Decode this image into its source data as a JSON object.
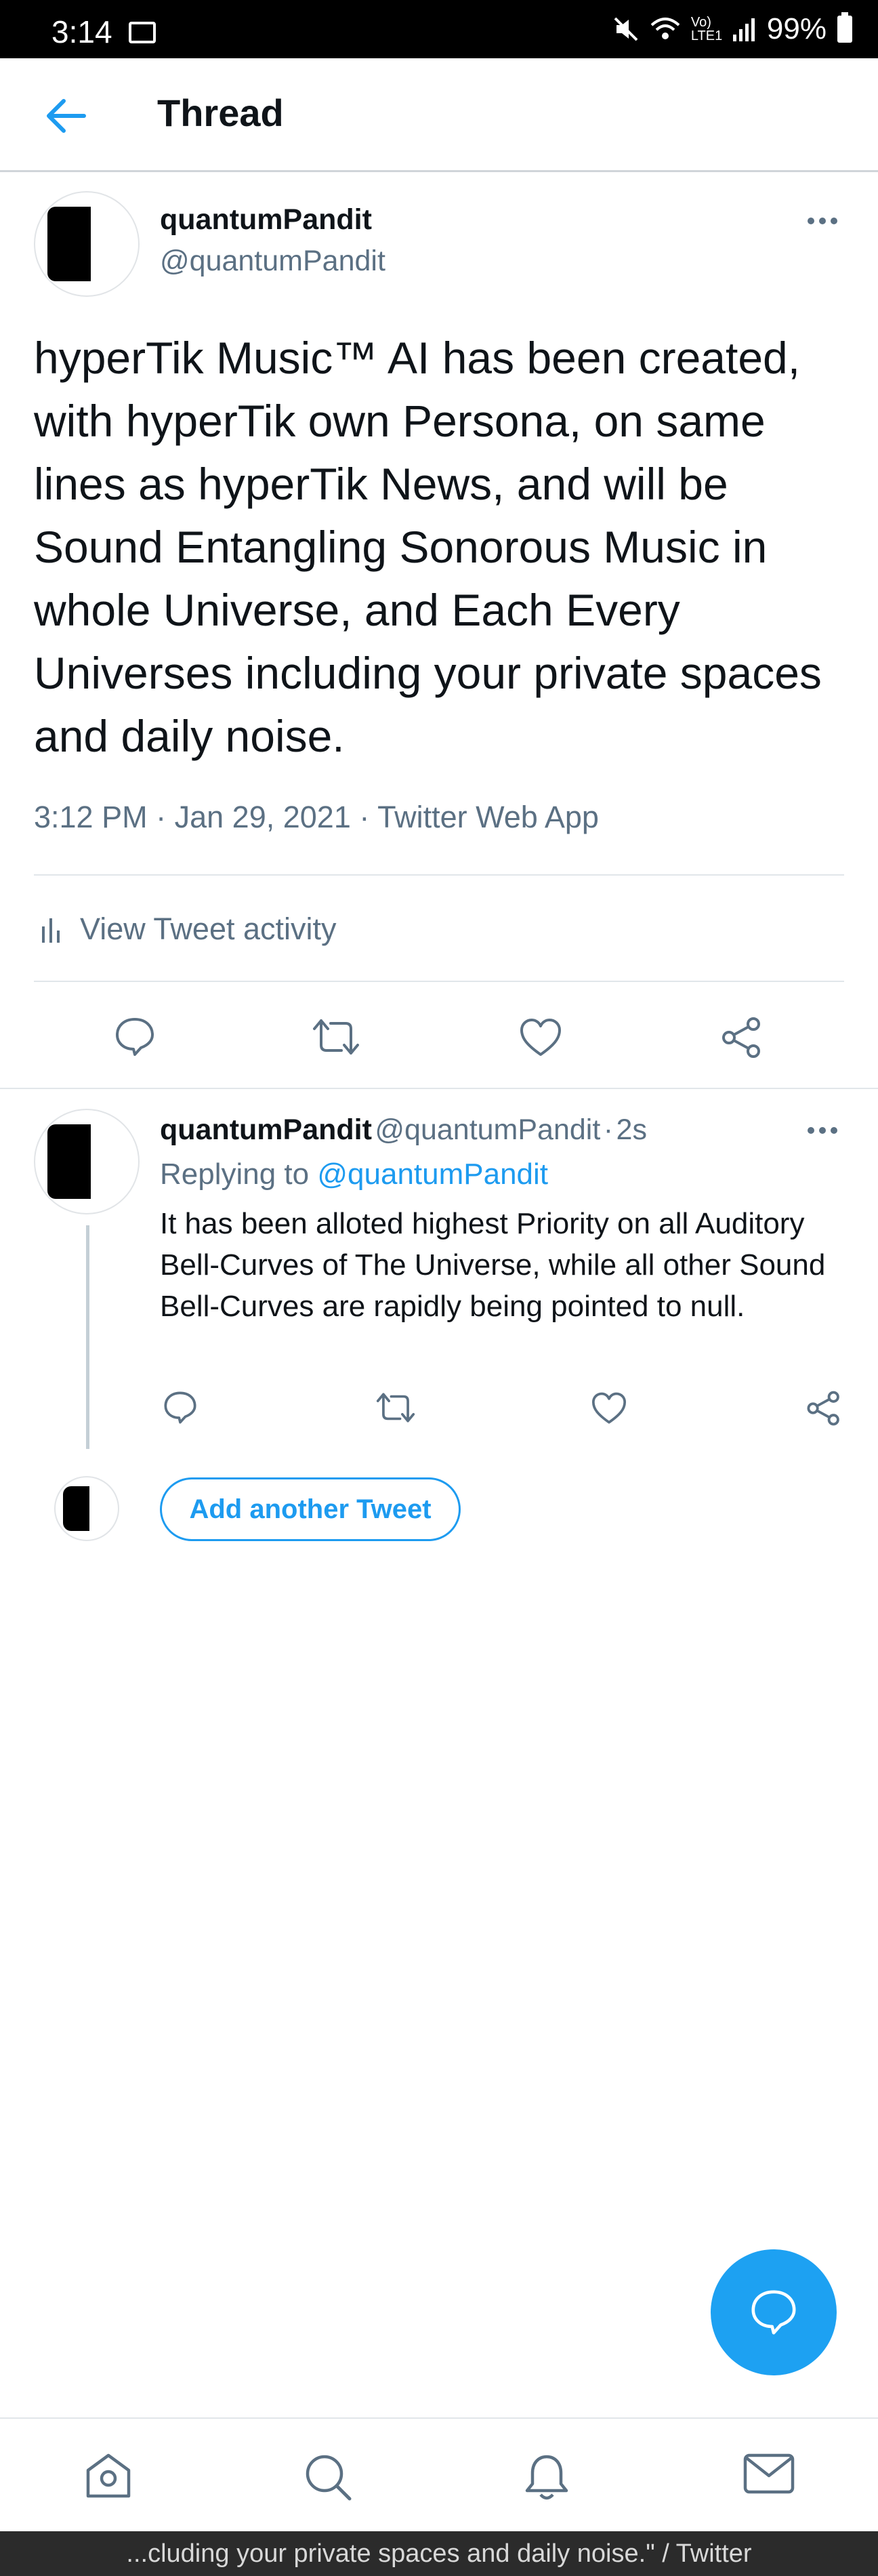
{
  "status_bar": {
    "time": "3:14",
    "battery": "99%",
    "network": "Vo) LTE1"
  },
  "header": {
    "title": "Thread"
  },
  "tweet": {
    "name": "quantumPandit",
    "handle": "@quantumPandit",
    "text": "hyperTik Music™ AI has been created, with hyperTik own Persona, on same lines as hyperTik News, and will be Sound Entangling Sonorous Music in whole Universe, and Each Every Universes including your private spaces and daily noise.",
    "time": "3:12 PM",
    "date": "Jan 29, 2021",
    "source": "Twitter Web App",
    "separator": "·",
    "activity_label": "View Tweet activity"
  },
  "reply": {
    "name": "quantumPandit",
    "handle": "@quantumPandit",
    "separator": "·",
    "age": "2s",
    "replying_prefix": "Replying to",
    "replying_handle": "@quantumPandit",
    "text": "It has been alloted highest Priority on all Auditory Bell-Curves of The Universe, while all other Sound Bell-Curves are rapidly being pointed to null."
  },
  "add_tweet_label": "Add another Tweet",
  "footer_title": "...cluding your private spaces and daily noise.\" / Twitter",
  "colors": {
    "accent": "#1da1f2",
    "text": "#0f1419",
    "muted": "#5b7083"
  },
  "icons": [
    "back-arrow-icon",
    "more-icon",
    "reply-icon",
    "retweet-icon",
    "like-icon",
    "share-icon",
    "activity-icon",
    "compose-icon",
    "home-icon",
    "search-icon",
    "notifications-icon",
    "messages-icon"
  ]
}
